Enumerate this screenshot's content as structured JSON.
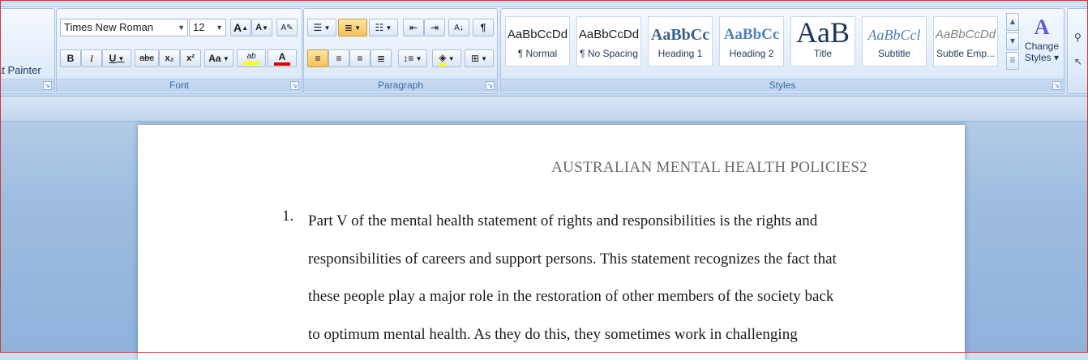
{
  "clipboard": {
    "format_painter_label": "at Painter"
  },
  "font": {
    "group_label": "Font",
    "font_name": "Times New Roman",
    "font_size": "12",
    "grow_glyph": "A",
    "shrink_glyph": "A",
    "bold": "B",
    "italic": "I",
    "underline": "U",
    "strike": "abc",
    "subscript": "x₂",
    "superscript": "x²",
    "change_case": "Aa",
    "highlight_glyph": "ab",
    "font_color_glyph": "A",
    "colors": {
      "highlight": "#ffff00",
      "font_color": "#e00000"
    }
  },
  "paragraph": {
    "group_label": "Paragraph",
    "show_marks_glyph": "¶"
  },
  "styles": {
    "group_label": "Styles",
    "items": [
      {
        "sample": "AaBbCcDd",
        "name": "¶ Normal"
      },
      {
        "sample": "AaBbCcDd",
        "name": "¶ No Spacing"
      },
      {
        "sample": "AaBbCc",
        "name": "Heading 1"
      },
      {
        "sample": "AaBbCc",
        "name": "Heading 2"
      },
      {
        "sample": "AaB",
        "name": "Title"
      },
      {
        "sample": "AaBbCcl",
        "name": "Subtitle"
      },
      {
        "sample": "AaBbCcDd",
        "name": "Subtle Emp..."
      }
    ],
    "change_styles_line1": "Change",
    "change_styles_line2": "Styles ▾"
  },
  "document": {
    "header": "AUSTRALIAN MENTAL HEALTH POLICIES2",
    "list_number": "1.",
    "lines": [
      "Part V of the mental health statement of rights and responsibilities is the rights and",
      "responsibilities of careers and support persons. This statement recognizes the fact that",
      "these people play a major role in the restoration of other members of the society back",
      "to optimum mental health. As they do this, they sometimes work in challenging"
    ]
  }
}
